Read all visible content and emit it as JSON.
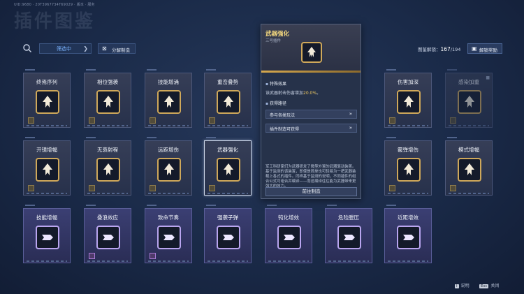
{
  "header": {
    "uid": "UID:9680 · 20T3967734T69029 · 版本 · 服务",
    "title": "插件图鉴",
    "filter_label": "筛选中",
    "decompose_label": "分解制造",
    "codex_label": "图鉴解锁：",
    "codex_count": "167",
    "codex_total": "/194",
    "reward_label": "解锁奖励"
  },
  "colors": {
    "gold_frame": "#cfa85a",
    "purple_frame": "#b9a5ef",
    "accent_text": "#f0c960",
    "filter_text": "#7ab3ff"
  },
  "cards": [
    {
      "name": "终焉序列",
      "icon": "pillars-icon",
      "rarity": "gold"
    },
    {
      "name": "相位强袭",
      "icon": "phase-strike-icon",
      "rarity": "gold"
    },
    {
      "name": "技能增涌",
      "icon": "surge-icon",
      "rarity": "gold"
    },
    {
      "name": "重峦叠势",
      "icon": "peaks-icon",
      "rarity": "gold"
    },
    {
      "name": "伤害加深",
      "icon": "damage-amplify-icon",
      "rarity": "gold"
    },
    {
      "name": "感染加重",
      "icon": "infection-icon",
      "rarity": "gold"
    },
    {
      "name": "开镜增幅",
      "icon": "scope-boost-icon",
      "rarity": "gold"
    },
    {
      "name": "无衰射程",
      "icon": "range-arrow-icon",
      "rarity": "gold"
    },
    {
      "name": "远距增伤",
      "icon": "long-range-icon",
      "rarity": "gold"
    },
    {
      "name": "武器强化",
      "icon": "weapon-enhance-icon",
      "rarity": "gold"
    },
    {
      "name": "霰弹增伤",
      "icon": "shotgun-icon",
      "rarity": "gold"
    },
    {
      "name": "模式增幅",
      "icon": "mode-boost-icon",
      "rarity": "gold"
    },
    {
      "name": "技能增幅",
      "icon": "skill-gun-icon",
      "rarity": "purple"
    },
    {
      "name": "叠浪效应",
      "icon": "wave-stack-icon",
      "rarity": "purple"
    },
    {
      "name": "致命节奏",
      "icon": "lethal-rhythm-icon",
      "rarity": "purple"
    },
    {
      "name": "强袭子弹",
      "icon": "assault-bullet-icon",
      "rarity": "purple"
    },
    {
      "name": "钝化增效",
      "icon": "blunt-icon",
      "rarity": "purple"
    },
    {
      "name": "危险膛压",
      "icon": "chamber-pressure-icon",
      "rarity": "purple"
    },
    {
      "name": "近距增效",
      "icon": "close-range-icon",
      "rarity": "purple"
    }
  ],
  "tooltip": {
    "title": "武器强化",
    "subtitle": "三号插件",
    "icon": "weapon-enhance-icon",
    "effect_heading": "特殊效果",
    "effect_text": "该武器射击伤害增加",
    "effect_value": "20.0%",
    "effect_end": "。",
    "path_heading": "获得路径",
    "path_1": "参与各类玩法",
    "path_2": "插件制造可获得",
    "description": "军工科研家们为武器研发了微型外置的武器驱动装置。基于监测的该装置，即使是简单也可轻易为一把武器装载上各式的插件。同样基于监测的说明，不同插件的组合公式可组合并编译——而这编译往往能为武器带来更强大的效力。",
    "craft_button": "前往制造"
  },
  "footer": {
    "help_key": "I",
    "help_label": "说明",
    "close_key": "Esc",
    "close_label": "关闭"
  }
}
